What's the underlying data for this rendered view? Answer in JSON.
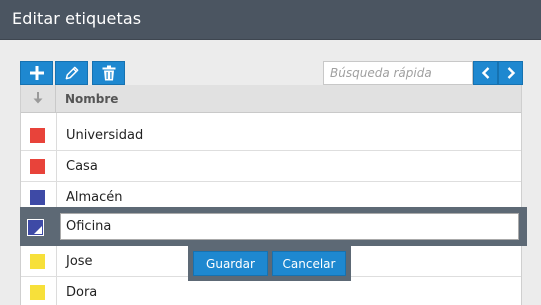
{
  "dialog": {
    "title": "Editar etiquetas"
  },
  "toolbar": {
    "add_icon": "plus-icon",
    "edit_icon": "pencil-icon",
    "delete_icon": "trash-icon"
  },
  "search": {
    "placeholder": "Búsqueda rápida",
    "value": ""
  },
  "navigation": {
    "prev_icon": "chevron-left-icon",
    "next_icon": "chevron-right-icon"
  },
  "grid": {
    "sort_icon": "arrow-down-icon",
    "column_header": "Nombre",
    "rows": [
      {
        "label": "Universidad",
        "color": "#e8433a"
      },
      {
        "label": "Casa",
        "color": "#e8433a"
      },
      {
        "label": "Almacén",
        "color": "#3e4aa6"
      },
      {
        "label": "Oficina",
        "color": "#3e4aa6"
      },
      {
        "label": "Jose",
        "color": "#f7e03a"
      },
      {
        "label": "Dora",
        "color": "#f7e03a"
      }
    ]
  },
  "editor": {
    "value": "Oficina",
    "save_label": "Guardar",
    "cancel_label": "Cancelar"
  },
  "colors": {
    "accent": "#1e88d0",
    "titlebar": "#4b5561",
    "edit_bar": "#5d6975"
  }
}
